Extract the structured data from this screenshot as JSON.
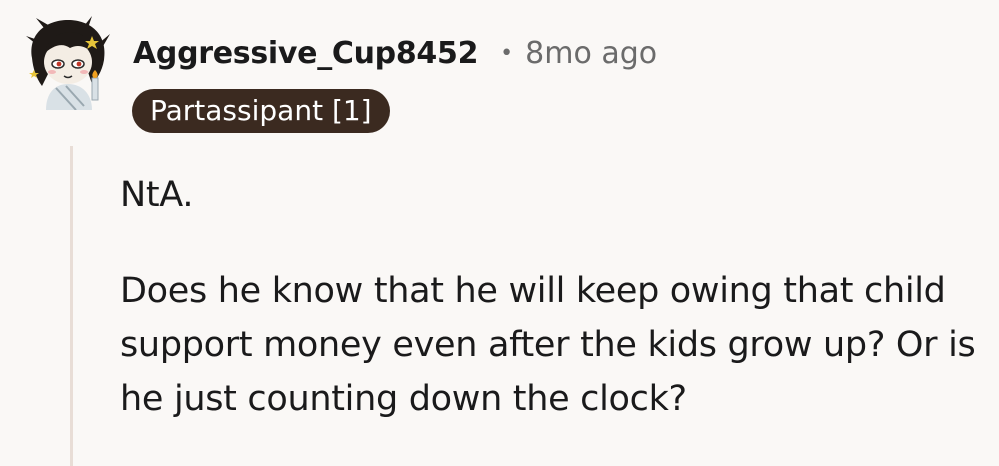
{
  "comment": {
    "author": "Aggressive_Cup8452",
    "separator": "•",
    "time_ago": "8mo ago",
    "flair": "Partassipant [1]",
    "paragraphs": [
      "NtA.",
      "Does he know that he will keep owing that child support money even after the kids grow up? Or is he just counting down the clock?"
    ]
  },
  "colors": {
    "background": "#faf8f6",
    "flair_bg": "#3b2a20",
    "flair_text": "#ffffff",
    "meta_text": "#6b6b6b",
    "thread_line": "#e8ddd6"
  },
  "icons": {
    "avatar": "user-avatar-icon"
  }
}
